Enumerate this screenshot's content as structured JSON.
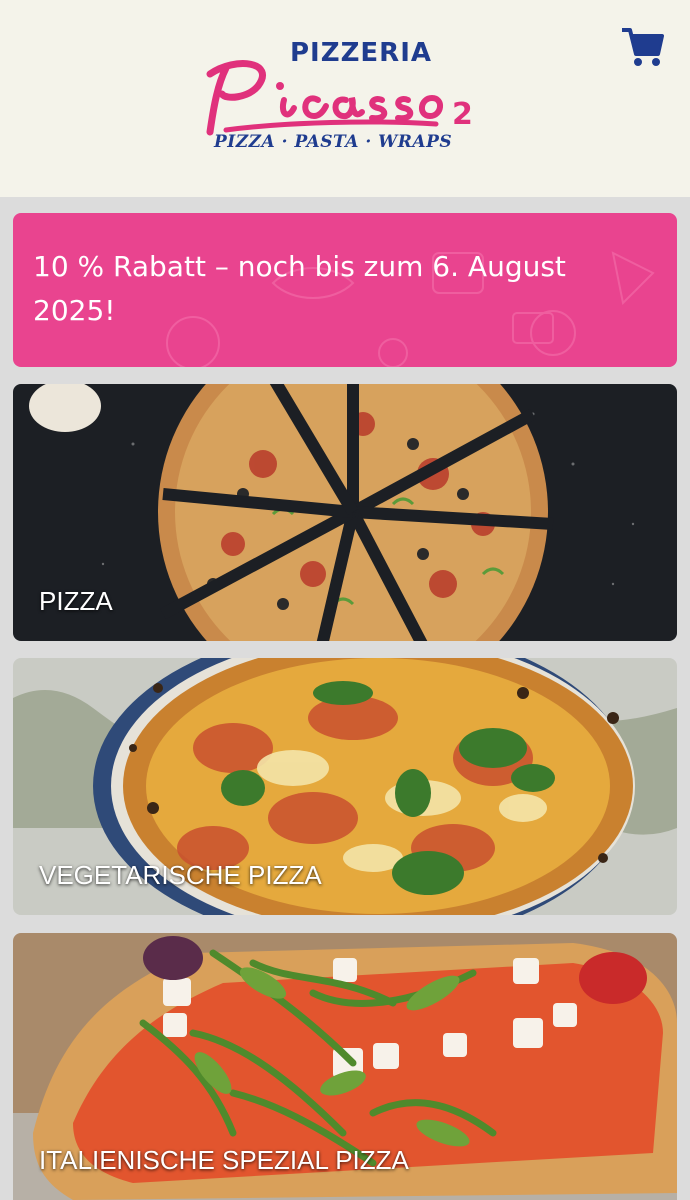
{
  "header": {
    "logo_top": "PIZZERIA",
    "logo_name": "Picasso",
    "logo_number": "2",
    "logo_tagline": "PIZZA · PASTA · WRAPS",
    "cart_icon": "shopping-cart-icon"
  },
  "promo": {
    "text": "10 % Rabatt – noch bis zum 6. August 2025!"
  },
  "categories": [
    {
      "label": "PIZZA"
    },
    {
      "label": "VEGETARISCHE PIZZA"
    },
    {
      "label": "ITALIENISCHE SPEZIAL PIZZA"
    }
  ],
  "colors": {
    "header_bg": "#f4f3ea",
    "brand_blue": "#1f3c8f",
    "brand_pink": "#e0317c",
    "promo_bg": "#e9448f"
  }
}
